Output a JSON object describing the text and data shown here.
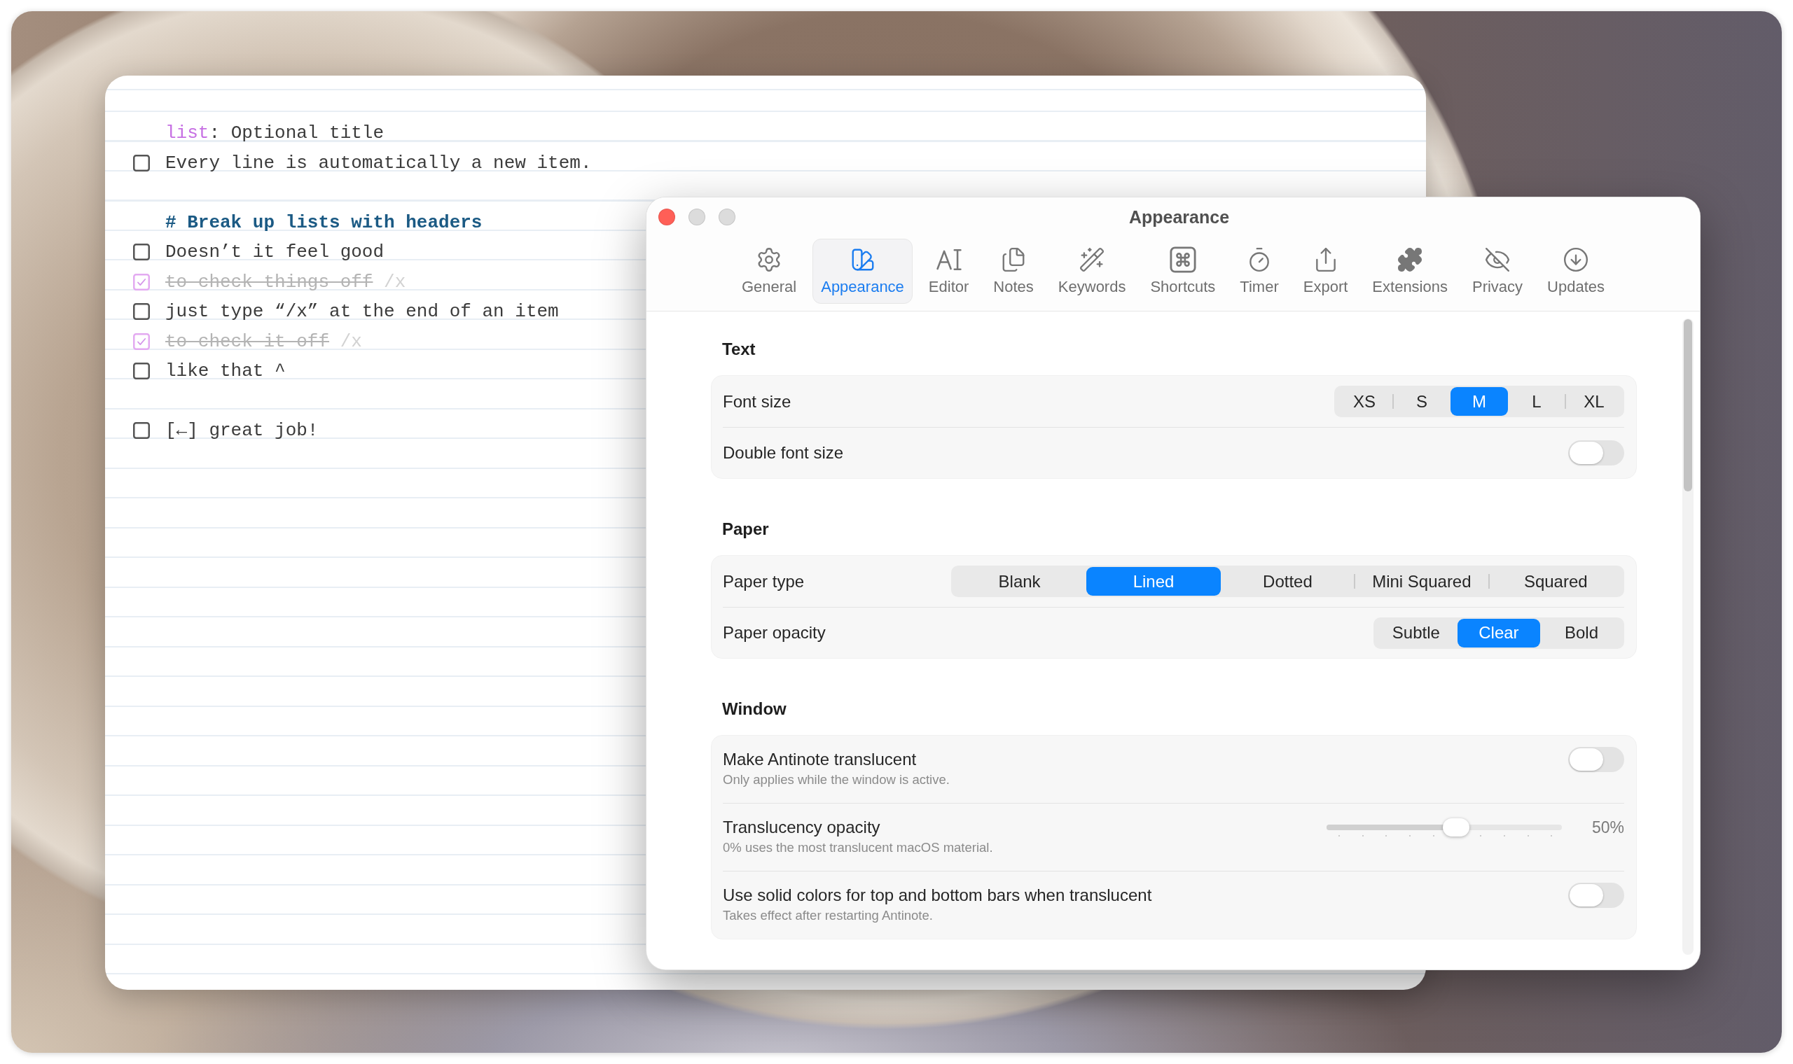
{
  "note": {
    "blocks": [
      {
        "lines": [
          {
            "kind": "title",
            "keyword": "list",
            "text": ": Optional title"
          },
          {
            "kind": "item",
            "text": "Every line is automatically a new item.",
            "checked": false
          }
        ]
      },
      {
        "lines": [
          {
            "kind": "header",
            "text": "# Break up lists with headers"
          },
          {
            "kind": "item",
            "text": "Doesn’t it feel good",
            "checked": false
          },
          {
            "kind": "item",
            "text": "to check things off",
            "suffix": "/x",
            "checked": true
          },
          {
            "kind": "item",
            "text": "just type “/x” at the end of an item",
            "checked": false
          },
          {
            "kind": "item",
            "text": "to check it off",
            "suffix": "/x",
            "checked": true
          },
          {
            "kind": "item",
            "text": "like that ^",
            "checked": false
          }
        ]
      },
      {
        "lines": [
          {
            "kind": "item",
            "text": "[←] great job!",
            "checked": false
          }
        ]
      }
    ]
  },
  "preferences": {
    "window_controls": [
      {
        "kind": "close",
        "disabled": false
      },
      {
        "kind": "minimize",
        "disabled": true
      },
      {
        "kind": "zoom",
        "disabled": true
      }
    ],
    "title": "Appearance",
    "tabs": [
      {
        "label": "General",
        "selected": false
      },
      {
        "label": "Appearance",
        "selected": true
      },
      {
        "label": "Editor",
        "selected": false
      },
      {
        "label": "Notes",
        "selected": false
      },
      {
        "label": "Keywords",
        "selected": false
      },
      {
        "label": "Shortcuts",
        "selected": false
      },
      {
        "label": "Timer",
        "selected": false
      },
      {
        "label": "Export",
        "selected": false
      },
      {
        "label": "Extensions",
        "selected": false
      },
      {
        "label": "Privacy",
        "selected": false
      },
      {
        "label": "Updates",
        "selected": false
      }
    ],
    "sections": [
      {
        "title": "Text",
        "rows": [
          {
            "kind": "segmented",
            "label": "Font size",
            "options": [
              {
                "label": "XS",
                "selected": false
              },
              {
                "label": "S",
                "selected": false
              },
              {
                "label": "M",
                "selected": true
              },
              {
                "label": "L",
                "selected": false
              },
              {
                "label": "XL",
                "selected": false
              }
            ]
          },
          {
            "kind": "toggle",
            "label": "Double font size",
            "on": false
          }
        ]
      },
      {
        "title": "Paper",
        "rows": [
          {
            "kind": "segmented",
            "label": "Paper type",
            "options": [
              {
                "label": "Blank",
                "selected": false
              },
              {
                "label": "Lined",
                "selected": true
              },
              {
                "label": "Dotted",
                "selected": false
              },
              {
                "label": "Mini Squared",
                "selected": false
              },
              {
                "label": "Squared",
                "selected": false
              }
            ]
          },
          {
            "kind": "segmented",
            "label": "Paper opacity",
            "options": [
              {
                "label": "Subtle",
                "selected": false
              },
              {
                "label": "Clear",
                "selected": true
              },
              {
                "label": "Bold",
                "selected": false
              }
            ]
          }
        ]
      },
      {
        "title": "Window",
        "rows": [
          {
            "kind": "toggle",
            "label": "Make Antinote translucent",
            "description": "Only applies while the window is active.",
            "on": false
          },
          {
            "kind": "slider",
            "label": "Translucency opacity",
            "description": "0% uses the most translucent macOS material.",
            "level": 0.55,
            "reading": "50%"
          },
          {
            "kind": "toggle",
            "label": "Use solid colors for top and bottom bars when translucent",
            "description": "Takes effect after restarting Antinote.",
            "on": false
          }
        ]
      }
    ]
  }
}
